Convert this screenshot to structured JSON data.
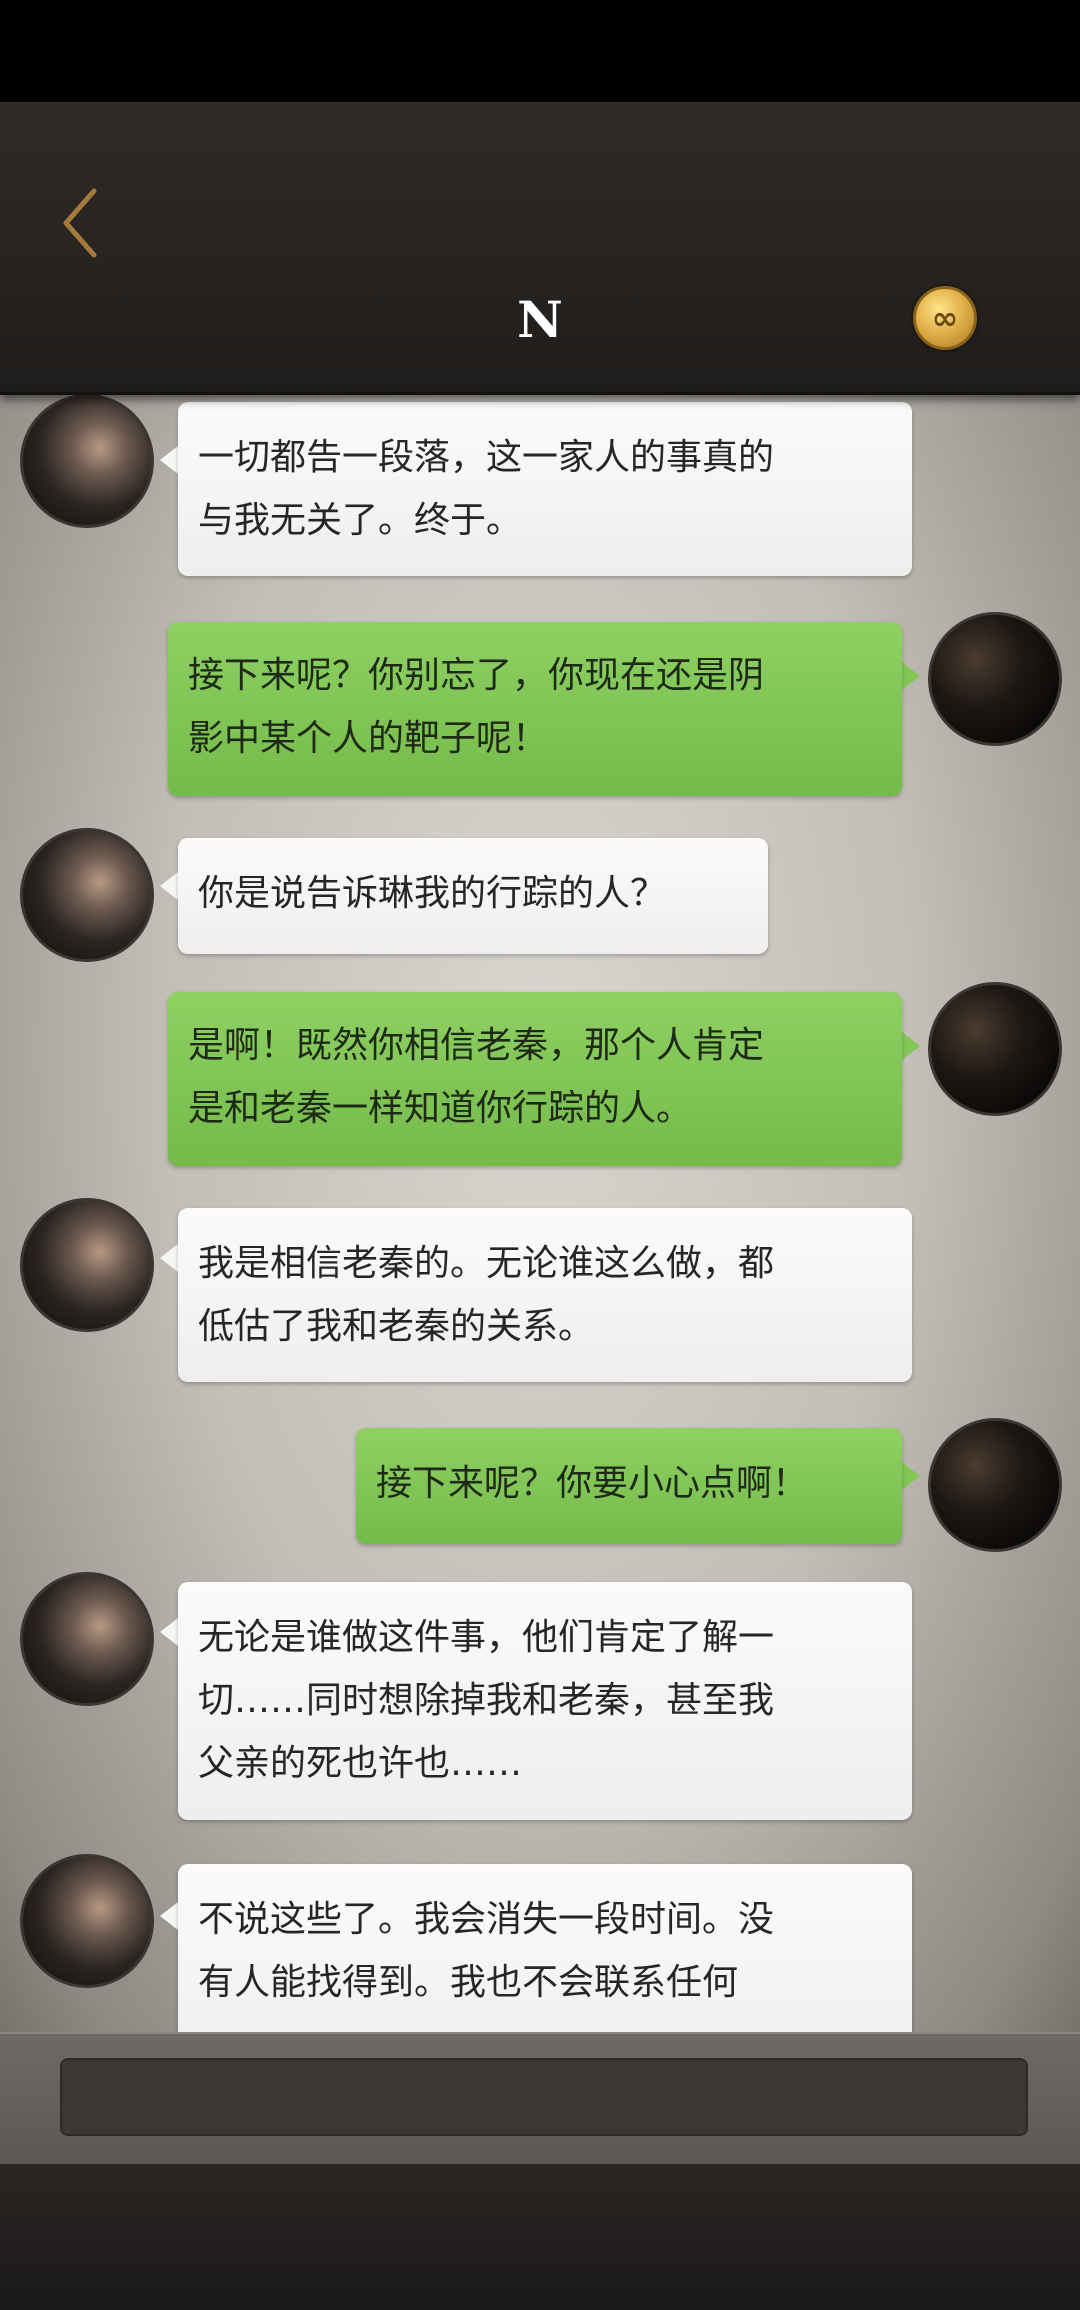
{
  "header": {
    "title": "N",
    "back_icon": "chevron-left-icon",
    "coin_icon": "infinity-coin-icon",
    "coin_symbol": "∞"
  },
  "colors": {
    "accent_green": "#7cc251",
    "bubble_white": "#f4f4f4",
    "header_bg": "#2a2725"
  },
  "messages": [
    {
      "side": "left",
      "lines": [
        "一切都告一段落，这一家人的事真的",
        "与我无关了。终于。"
      ]
    },
    {
      "side": "right",
      "lines": [
        "接下来呢？你别忘了，你现在还是阴",
        "影中某个人的靶子呢！"
      ]
    },
    {
      "side": "left",
      "lines": [
        "你是说告诉琳我的行踪的人？"
      ]
    },
    {
      "side": "right",
      "lines": [
        "是啊！既然你相信老秦，那个人肯定",
        "是和老秦一样知道你行踪的人。"
      ]
    },
    {
      "side": "left",
      "lines": [
        "我是相信老秦的。无论谁这么做，都",
        "低估了我和老秦的关系。"
      ]
    },
    {
      "side": "right",
      "lines": [
        "接下来呢？你要小心点啊！"
      ]
    },
    {
      "side": "left",
      "lines": [
        "无论是谁做这件事，他们肯定了解一",
        "切……同时想除掉我和老秦，甚至我",
        "父亲的死也许也……"
      ]
    },
    {
      "side": "left",
      "lines": [
        "不说这些了。我会消失一段时间。没",
        "有人能找得到。我也不会联系任何"
      ]
    }
  ],
  "input": {
    "placeholder": ""
  }
}
